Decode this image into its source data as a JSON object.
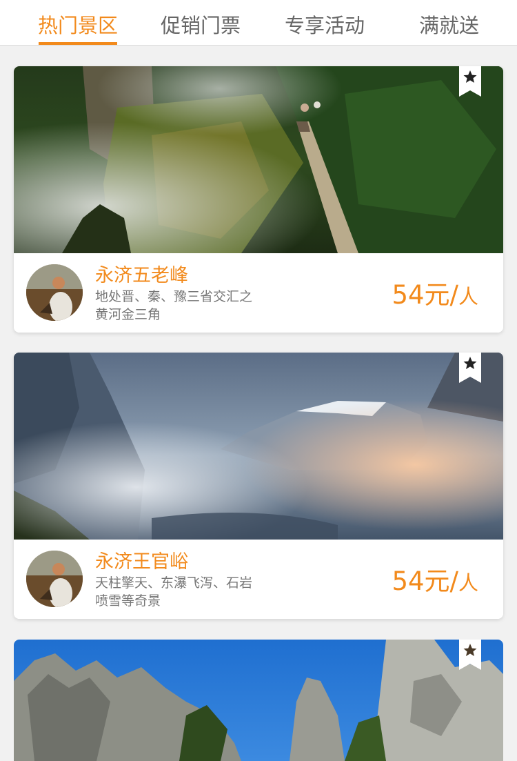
{
  "tabs": [
    {
      "label": "热门景区",
      "active": true
    },
    {
      "label": "促销门票",
      "active": false
    },
    {
      "label": "专享活动",
      "active": false
    },
    {
      "label": "满就送",
      "active": false
    }
  ],
  "colors": {
    "accent": "#f28a1c",
    "tab_inactive": "#666666",
    "desc": "#777777"
  },
  "bookmark_icon": "star-bookmark-icon",
  "cards": [
    {
      "title": "永济五老峰",
      "desc": "地处晋、秦、豫三省交汇之黄河金三角",
      "price": "54元/",
      "unit": "人"
    },
    {
      "title": "永济王官峪",
      "desc": "天柱擎天、东瀑飞泻、石岩喷雪等奇景",
      "price": "54元/",
      "unit": "人"
    }
  ]
}
